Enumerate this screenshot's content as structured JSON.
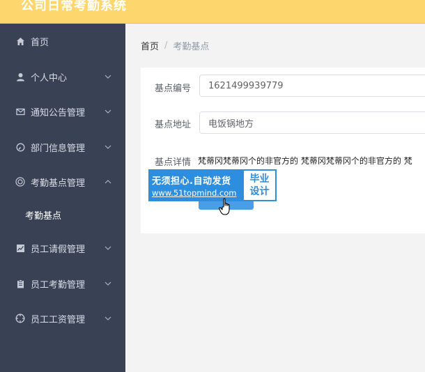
{
  "app": {
    "title": "公司日常考勤系统"
  },
  "sidebar": {
    "items": [
      {
        "label": "首页",
        "icon": "home-icon"
      },
      {
        "label": "个人中心",
        "icon": "user-icon"
      },
      {
        "label": "通知公告管理",
        "icon": "mail-icon"
      },
      {
        "label": "部门信息管理",
        "icon": "gauge-icon"
      },
      {
        "label": "考勤基点管理",
        "icon": "target-icon"
      },
      {
        "label": "员工请假管理",
        "icon": "chart-icon"
      },
      {
        "label": "员工考勤管理",
        "icon": "clipboard-icon"
      },
      {
        "label": "员工工资管理",
        "icon": "crosshair-icon"
      }
    ],
    "submenu": {
      "label": "考勤基点"
    }
  },
  "breadcrumb": {
    "home": "首页",
    "separator": "/",
    "current": "考勤基点"
  },
  "form": {
    "id_label": "基点编号",
    "id_value": "1621499939779",
    "address_label": "基点地址",
    "address_value": "电饭锅地方",
    "detail_label": "基点详情",
    "detail_value": "梵蒂冈梵蒂冈个的非官方的 梵蒂冈梵蒂冈个的非官方的 梵"
  },
  "watermark": {
    "line1": "无须担心.自动发货",
    "line2": "www.51topmind.com",
    "right_line1": "毕业",
    "right_line2": "设计"
  },
  "colors": {
    "header": "#fdd76e",
    "sidebar": "#394254",
    "accent": "#2d8ee0"
  }
}
